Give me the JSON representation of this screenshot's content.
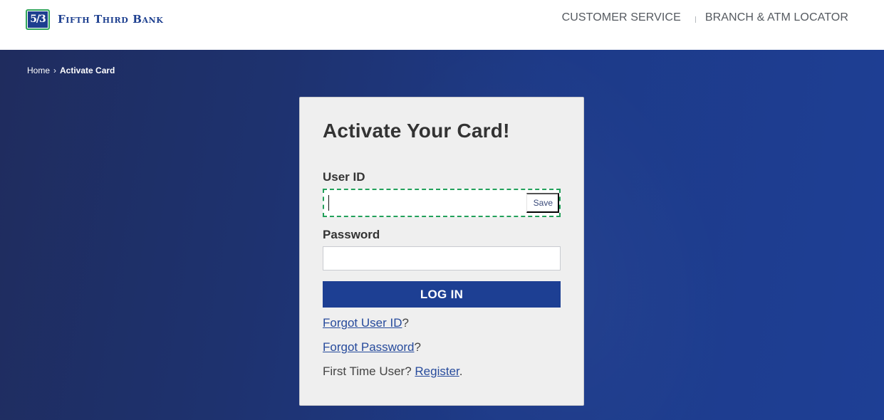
{
  "header": {
    "logo_mark": "5/3",
    "logo_text": "Fifth Third Bank",
    "nav": [
      {
        "label": "CUSTOMER SERVICE"
      },
      {
        "label": "BRANCH & ATM LOCATOR"
      }
    ]
  },
  "breadcrumb": {
    "home": "Home",
    "separator": "›",
    "current": "Activate Card"
  },
  "card": {
    "title": "Activate Your Card!",
    "user_id_label": "User ID",
    "user_id_value": "",
    "save_label": "Save",
    "password_label": "Password",
    "password_value": "",
    "login_label": "LOG IN",
    "forgot_user_id_link": "Forgot User ID",
    "forgot_user_id_suffix": "?",
    "forgot_password_link": "Forgot Password",
    "forgot_password_suffix": "?",
    "first_time_text": "First Time User? ",
    "register_link": "Register",
    "register_suffix": "."
  },
  "colors": {
    "brand_blue": "#1d3f93",
    "focus_green": "#22a05a",
    "link_blue": "#274b9c",
    "card_bg": "#efefef"
  }
}
